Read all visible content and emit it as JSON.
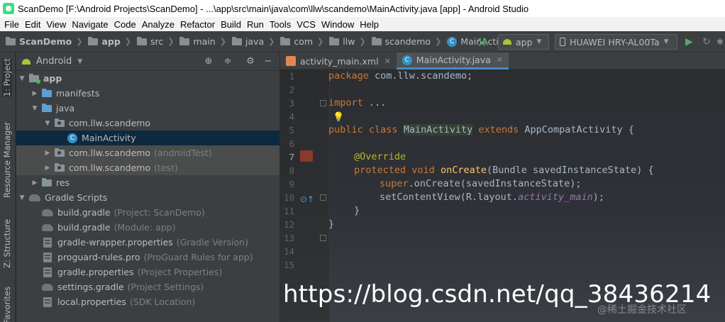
{
  "window": {
    "title": "ScanDemo [F:\\Android Projects\\ScanDemo] - ...\\app\\src\\main\\java\\com\\llw\\scandemo\\MainActivity.java [app] - Android Studio"
  },
  "menu": [
    "File",
    "Edit",
    "View",
    "Navigate",
    "Code",
    "Analyze",
    "Refactor",
    "Build",
    "Run",
    "Tools",
    "VCS",
    "Window",
    "Help"
  ],
  "breadcrumbs": [
    "ScanDemo",
    "app",
    "src",
    "main",
    "java",
    "com",
    "llw",
    "scandemo",
    "MainActivity"
  ],
  "toolbar": {
    "run_config": "app",
    "device": "HUAWEI HRY-AL00Ta"
  },
  "tool_windows": {
    "project": "1: Project",
    "resource_manager": "Resource Manager",
    "structure": "Z: Structure",
    "favorites": "Favorites"
  },
  "project_panel": {
    "view_mode": "Android",
    "tree": [
      {
        "label": "app",
        "hint": ""
      },
      {
        "label": "manifests",
        "hint": ""
      },
      {
        "label": "java",
        "hint": ""
      },
      {
        "label": "com.llw.scandemo",
        "hint": ""
      },
      {
        "label": "MainActivity",
        "hint": ""
      },
      {
        "label": "com.llw.scandemo",
        "hint": "(androidTest)"
      },
      {
        "label": "com.llw.scandemo",
        "hint": "(test)"
      },
      {
        "label": "res",
        "hint": ""
      },
      {
        "label": "Gradle Scripts",
        "hint": ""
      },
      {
        "label": "build.gradle",
        "hint": "(Project: ScanDemo)"
      },
      {
        "label": "build.gradle",
        "hint": "(Module: app)"
      },
      {
        "label": "gradle-wrapper.properties",
        "hint": "(Gradle Version)"
      },
      {
        "label": "proguard-rules.pro",
        "hint": "(ProGuard Rules for app)"
      },
      {
        "label": "gradle.properties",
        "hint": "(Project Properties)"
      },
      {
        "label": "settings.gradle",
        "hint": "(Project Settings)"
      },
      {
        "label": "local.properties",
        "hint": "(SDK Location)"
      }
    ]
  },
  "editor": {
    "tabs": [
      {
        "label": "activity_main.xml",
        "active": false
      },
      {
        "label": "MainActivity.java",
        "active": true
      }
    ],
    "line_numbers": [
      "1",
      "2",
      "3",
      "4",
      "5",
      "6",
      "7",
      "8",
      "9",
      "10",
      "11",
      "12",
      "13",
      "14",
      "15"
    ],
    "code": {
      "l1_kw": "package",
      "l1_rest": " com.llw.scandemo;",
      "l3_kw": "import",
      "l3_rest": " ...",
      "l7_kw1": "public class",
      "l7_name": "MainActivity",
      "l7_kw2": "extends",
      "l7_rest": " AppCompatActivity {",
      "l9_ann": "@Override",
      "l10_kw": "protected void",
      "l10_fn": "onCreate",
      "l10_rest": "(Bundle savedInstanceState) {",
      "l11_kw": "super",
      "l11_rest": ".onCreate(savedInstanceState);",
      "l12_a": "setContentView(R.layout.",
      "l12_it": "activity_main",
      "l12_b": ");",
      "l13": "}",
      "l14": "}"
    }
  },
  "watermark": {
    "url": "https://blog.csdn.net/qq_38436214",
    "small": "@稀土掘金技术社区"
  }
}
